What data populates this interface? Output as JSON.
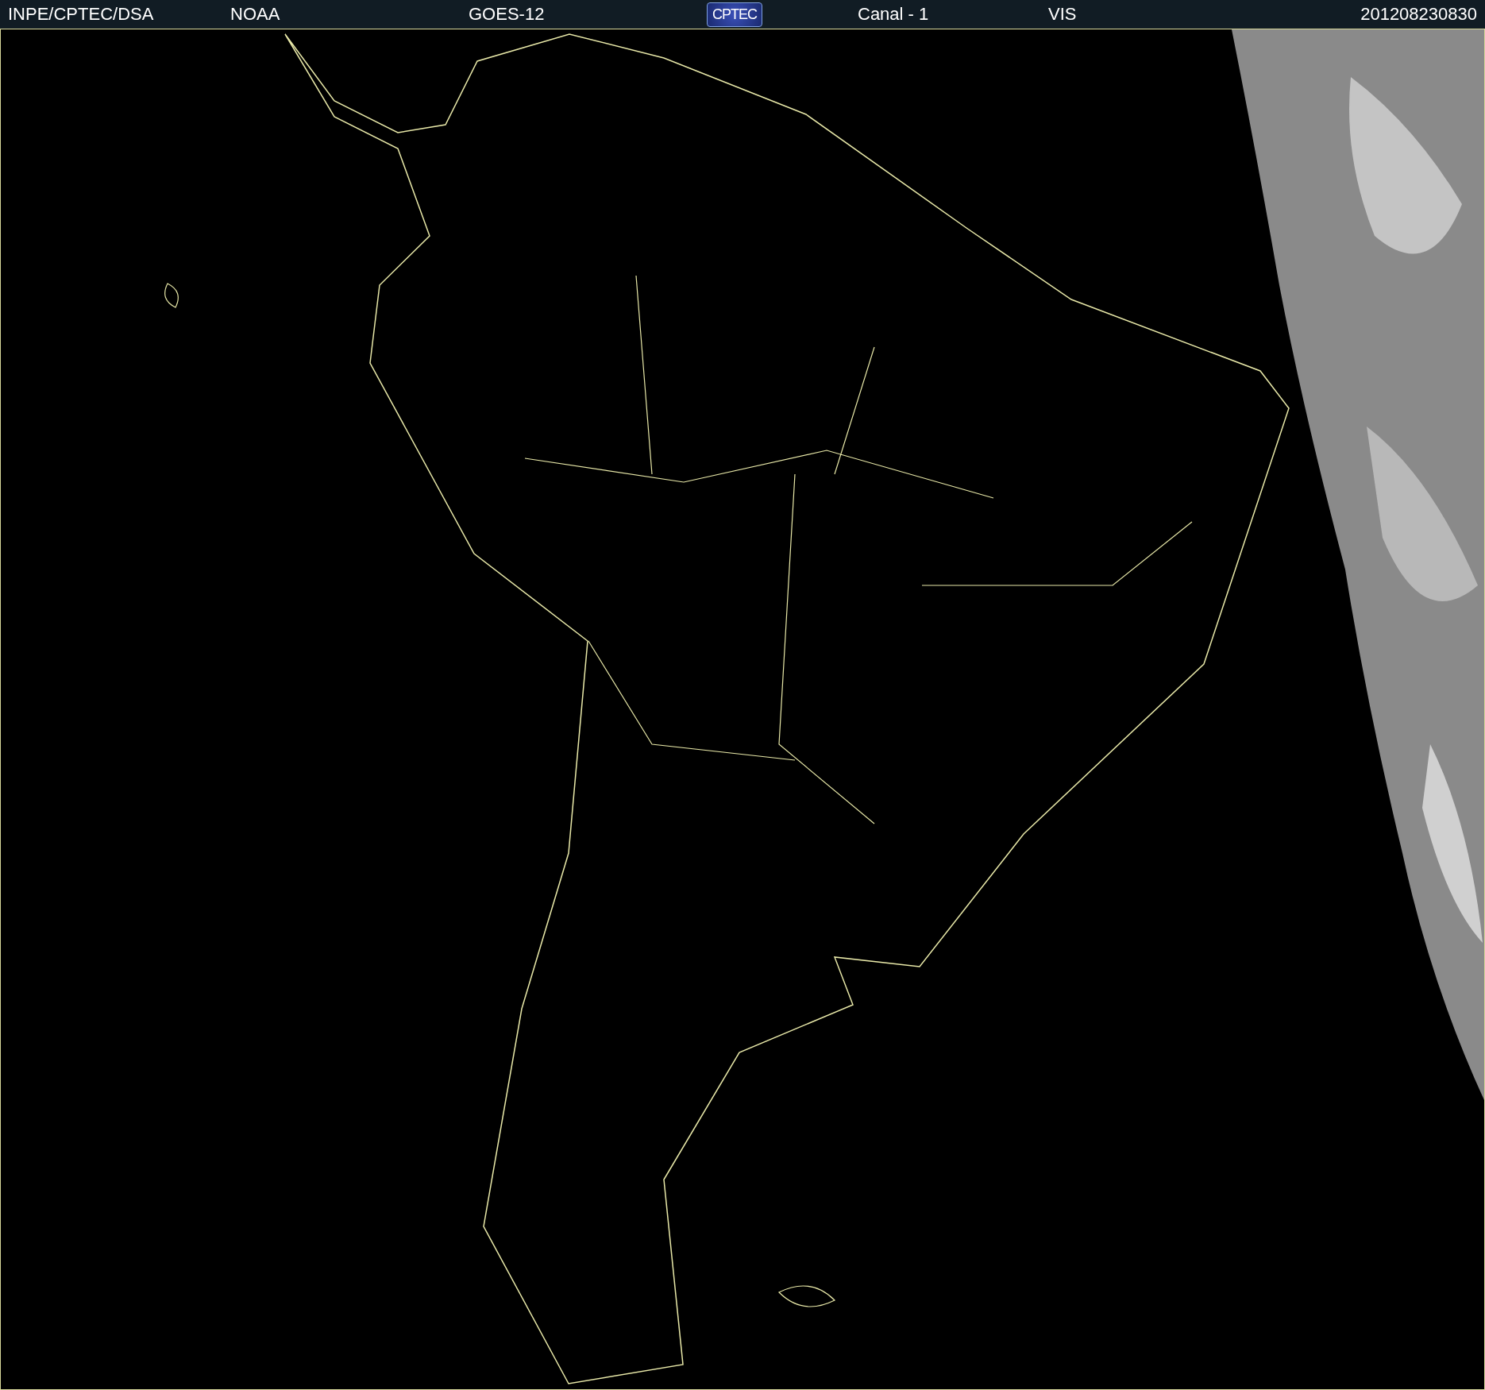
{
  "header": {
    "items": [
      {
        "kind": "text",
        "text": "INPE/CPTEC/DSA"
      },
      {
        "kind": "text",
        "text": "NOAA"
      },
      {
        "kind": "text",
        "text": "GOES-12"
      },
      {
        "kind": "logo",
        "text": "CPTEC"
      },
      {
        "kind": "text",
        "text": "Canal - 1"
      },
      {
        "kind": "text",
        "text": "VIS"
      },
      {
        "kind": "text",
        "text": "201208230830"
      }
    ]
  }
}
